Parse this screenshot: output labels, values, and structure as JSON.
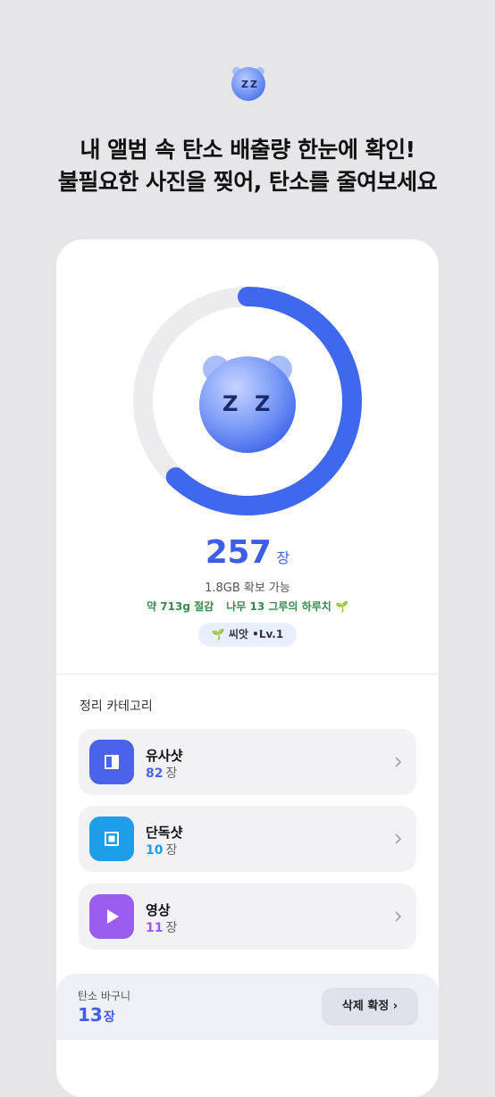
{
  "header": {
    "line1": "내 앨범 속 탄소 배출량 한눈에 확인!",
    "line2": "불필요한 사진을 찢어, 탄소를 줄여보세요"
  },
  "summary": {
    "progress": 0.62,
    "photo_count": "257",
    "photo_unit": "장",
    "storage": "1.8GB 확보 가능",
    "carbon": "약 713g 절감",
    "trees": "나무 13 그루의 하루치 🌱",
    "level": "🌱 씨앗 •Lv.1"
  },
  "categories_title": "정리 카테고리",
  "categories": [
    {
      "name": "유사샷",
      "count": "82",
      "unit": "장",
      "color": "#4a63e8",
      "icon": "split-square-icon"
    },
    {
      "name": "단독샷",
      "count": "10",
      "unit": "장",
      "color": "#1e9ee8",
      "icon": "single-square-icon"
    },
    {
      "name": "영상",
      "count": "11",
      "unit": "장",
      "color": "#9b5cf0",
      "icon": "play-icon"
    }
  ],
  "basket": {
    "label": "탄소 바구니",
    "count": "13",
    "unit": "장",
    "button": "삭제 확정 ›"
  },
  "colors": {
    "accent": "#3f5ee6",
    "green": "#3a8a4f",
    "ring_track": "#ececee"
  }
}
